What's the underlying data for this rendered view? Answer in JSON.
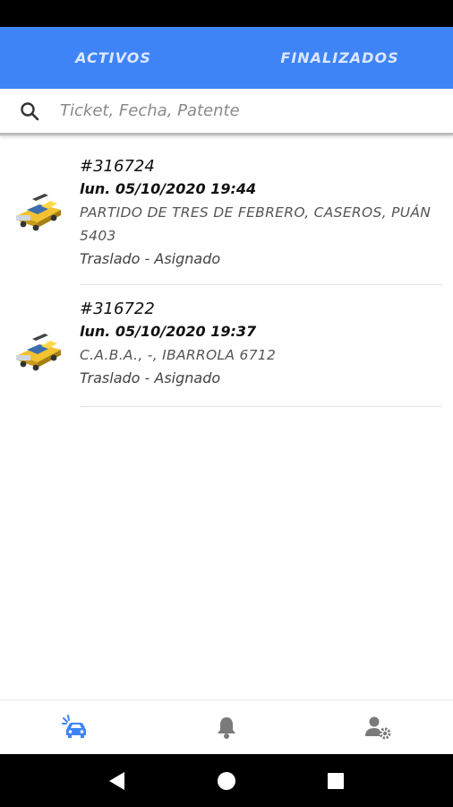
{
  "tabs": [
    {
      "label": "ACTIVOS"
    },
    {
      "label": "FINALIZADOS"
    }
  ],
  "search": {
    "placeholder": "Ticket, Fecha, Patente",
    "icon": "search-icon"
  },
  "tickets": [
    {
      "number": "#316724",
      "date": "lun. 05/10/2020 19:44",
      "address": "PARTIDO DE TRES DE FEBRERO, CASEROS, PUÁN 5403",
      "status": "Traslado - Asignado",
      "icon": "tow-truck-icon"
    },
    {
      "number": "#316722",
      "date": "lun. 05/10/2020 19:37",
      "address": "C.A.B.A., -, IBARROLA 6712",
      "status": "Traslado - Asignado",
      "icon": "tow-truck-icon"
    }
  ],
  "bottom_nav": [
    {
      "name": "services",
      "icon": "car-assist-icon",
      "active": true
    },
    {
      "name": "notifications",
      "icon": "bell-icon",
      "active": false
    },
    {
      "name": "profile-settings",
      "icon": "user-settings-icon",
      "active": false
    }
  ],
  "colors": {
    "header": "#3f84f6",
    "active_nav": "#3f84f6",
    "inactive_nav": "#7a7a7a"
  }
}
